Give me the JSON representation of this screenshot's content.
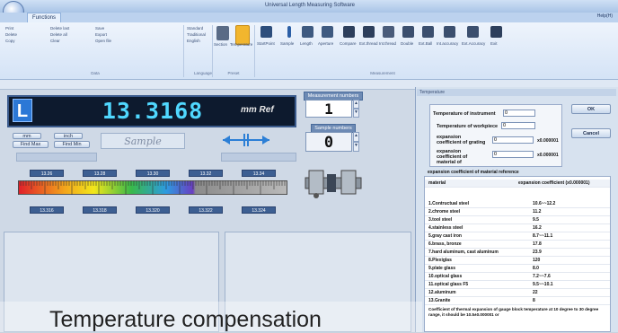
{
  "window": {
    "title": "Universal Length Measuring Software",
    "help": "Help(H)"
  },
  "ribbon": {
    "tab": "Functions",
    "groups": [
      {
        "label": "Data",
        "items": [
          "Print",
          "Delete",
          "Copy",
          "Delete last",
          "Delete all",
          "Clear",
          "Save",
          "Export",
          "Open file"
        ]
      },
      {
        "label": "Language",
        "items": [
          "Standard",
          "Traditional",
          "English"
        ]
      },
      {
        "label": "Preset",
        "items": [
          "Section",
          "Temperature"
        ]
      },
      {
        "label": "Measurement",
        "items": [
          "StartPoint",
          "Sample",
          "Length",
          "Aperture",
          "Compare",
          "Ext.thread",
          "Int.thread",
          "Double",
          "Ext.Ball",
          "Int.accuracy",
          "Ext.Accuracy",
          "Exit"
        ]
      }
    ]
  },
  "readout": {
    "value": "13.3168",
    "unit": "mm Ref",
    "badge": "L"
  },
  "measurement": {
    "number_label": "Measurement numbers",
    "number": "1",
    "sample_label": "Sample numbers",
    "sample": "0"
  },
  "buttons": {
    "mm": "mm",
    "inch": "inch",
    "find_max": "Find Max",
    "find_min": "Find Min"
  },
  "sample_box": "Sample",
  "scale": {
    "top": [
      "13.26",
      "13.28",
      "13.30",
      "13.32",
      "13.34"
    ],
    "bottom": [
      "13.316",
      "13.318",
      "13.320",
      "13.322",
      "13.324"
    ]
  },
  "temperature_panel": {
    "title": "Temperature",
    "fields": [
      {
        "label": "Temperature of instrument",
        "value": "0",
        "unit": ""
      },
      {
        "label": "Temperature of workpiece",
        "value": "0",
        "unit": ""
      },
      {
        "label": "expansion coefficient of grating",
        "value": "0",
        "unit": "x0.000001"
      },
      {
        "label": "expansion coefficient of material of",
        "value": "0",
        "unit": "x0.000001"
      }
    ],
    "ok": "OK",
    "cancel": "Cancel",
    "ref_title": "expansion coefficient of material reference",
    "ref_headers": [
      "material",
      "expansion coefficient (x0.000001)"
    ],
    "ref_rows": [
      [
        "1.Contructual steel",
        "10.6~~12.2"
      ],
      [
        "2.chrome steel",
        "11.2"
      ],
      [
        "3.tool steel",
        "9.5"
      ],
      [
        "4.stainless steel",
        "16.2"
      ],
      [
        "5.gray cast iron",
        "8.7~~11.1"
      ],
      [
        "6.brass, bronze",
        "17.8"
      ],
      [
        "7.hard aluminum, cast aluminum",
        "23.9"
      ],
      [
        "8.Plexiglas",
        "120"
      ],
      [
        "9.plate glass",
        "8.0"
      ],
      [
        "10.optical glass",
        "7.2~~7.6"
      ],
      [
        "11.optical glass F5",
        "9.5~~10.1"
      ],
      [
        "12.aluminum",
        "22"
      ],
      [
        "13.Granite",
        "8"
      ]
    ],
    "note": "Coefficient of thermal expansion of gauge block temperature at 10 degree to 30 degree range, it should be 10.5±0.000001 or"
  },
  "caption": "Temperature compensation"
}
